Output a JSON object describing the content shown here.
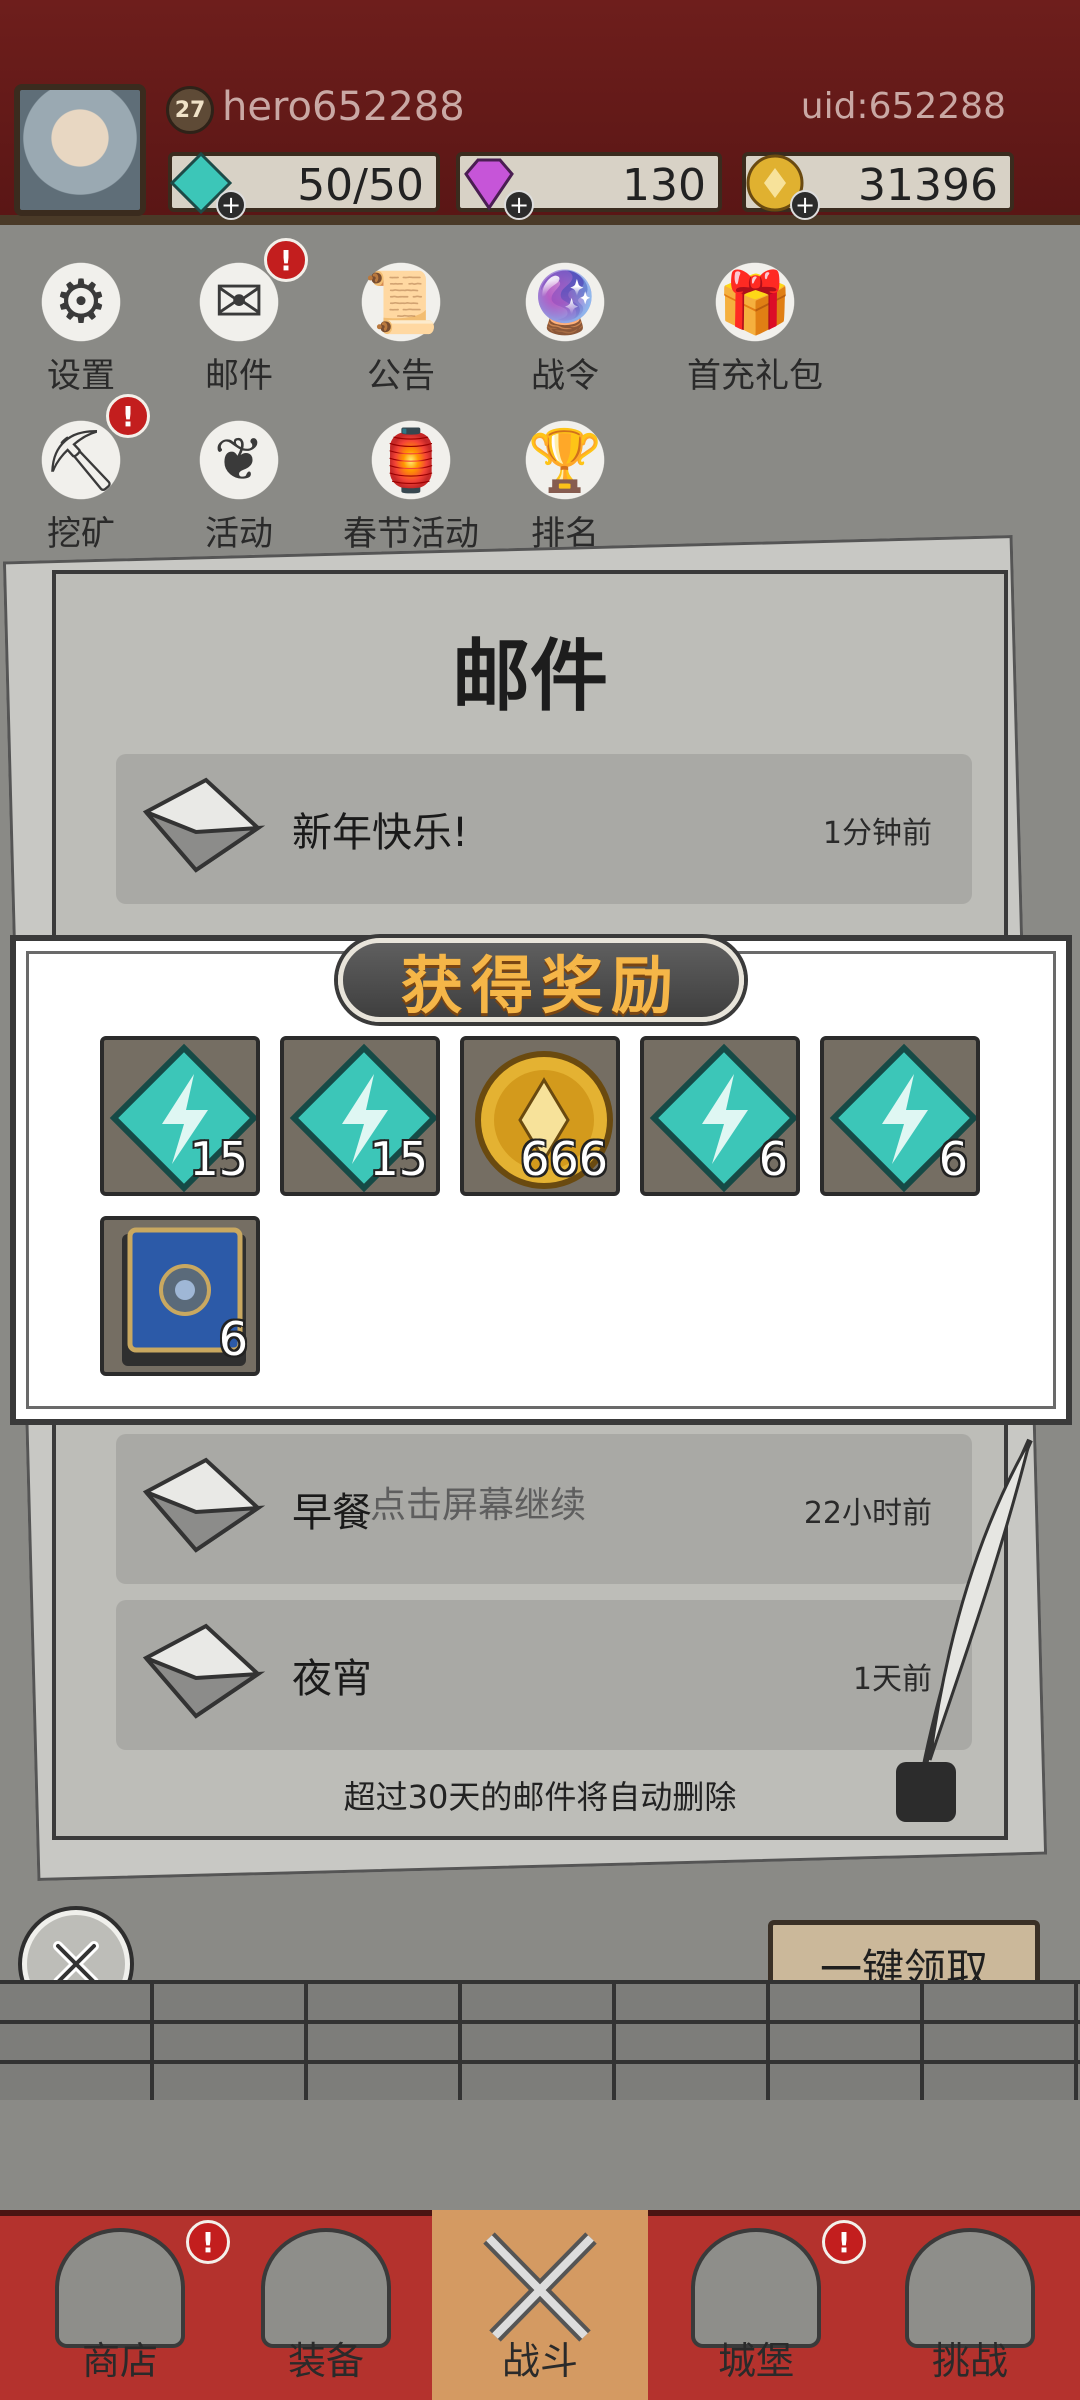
{
  "header": {
    "level": "27",
    "player_name": "hero652288",
    "uid": "uid:652288",
    "resources": [
      {
        "icon": "energy-gem-icon",
        "value": "50/50"
      },
      {
        "icon": "purple-diamond-icon",
        "value": "130"
      },
      {
        "icon": "gold-coin-icon",
        "value": "31396"
      }
    ]
  },
  "menu": [
    {
      "label": "设置",
      "icon": "gear-icon",
      "alert": false
    },
    {
      "label": "邮件",
      "icon": "envelope-icon",
      "alert": true
    },
    {
      "label": "公告",
      "icon": "scroll-icon",
      "alert": false
    },
    {
      "label": "战令",
      "icon": "crystal-ball-icon",
      "alert": false
    },
    {
      "label": "首充礼包",
      "icon": "gift-bag-icon",
      "alert": false
    },
    {
      "label": "挖矿",
      "icon": "mining-icon",
      "alert": true
    },
    {
      "label": "活动",
      "icon": "laurel-icon",
      "alert": false
    },
    {
      "label": "春节活动",
      "icon": "lantern-icon",
      "alert": false
    },
    {
      "label": "排名",
      "icon": "ranking-icon",
      "alert": false
    }
  ],
  "alert_mark": "!",
  "mail": {
    "title": "邮件",
    "items": [
      {
        "subject": "新年快乐!",
        "time": "1分钟前"
      },
      {
        "subject": "早餐",
        "time": "22小时前"
      },
      {
        "subject": "夜宵",
        "time": "1天前"
      }
    ],
    "continue_hint": "点击屏幕继续",
    "footer_note": "超过30天的邮件将自动删除",
    "claim_all_label": "一键领取"
  },
  "rewards": {
    "title": "获得奖励",
    "items": [
      {
        "icon": "energy-gem-icon",
        "qty": "15"
      },
      {
        "icon": "energy-gem-icon",
        "qty": "15"
      },
      {
        "icon": "gold-coin-icon",
        "qty": "666"
      },
      {
        "icon": "energy-gem-icon",
        "qty": "6"
      },
      {
        "icon": "energy-gem-icon",
        "qty": "6"
      },
      {
        "icon": "spell-book-icon",
        "qty": "6"
      }
    ]
  },
  "tabs": [
    {
      "label": "商店",
      "alert": true
    },
    {
      "label": "装备",
      "alert": false
    },
    {
      "label": "战斗",
      "alert": false,
      "active": true
    },
    {
      "label": "城堡",
      "alert": true
    },
    {
      "label": "挑战",
      "alert": false
    }
  ],
  "colors": {
    "header_red": "#6e1e1c",
    "alert_red": "#c31e1e",
    "reward_gold": "#f5b648",
    "energy_teal": "#3cc6b8",
    "tabbar_red": "#b4322d"
  }
}
